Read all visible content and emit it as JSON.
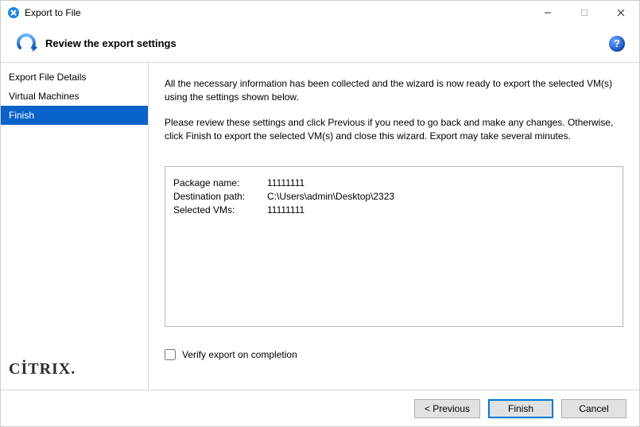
{
  "window": {
    "title": "Export to File"
  },
  "header": {
    "title": "Review the export settings"
  },
  "sidebar": {
    "items": [
      {
        "label": "Export File Details",
        "active": false
      },
      {
        "label": "Virtual Machines",
        "active": false
      },
      {
        "label": "Finish",
        "active": true
      }
    ],
    "brand": "CİTRIX",
    "brand_dot": "."
  },
  "content": {
    "para1": "All the necessary information has been collected and the wizard is now ready to export the selected VM(s) using the settings shown below.",
    "para2": "Please review these settings and click Previous if you need to go back and make any changes. Otherwise, click Finish to export the selected VM(s) and close this wizard. Export may take several minutes.",
    "settings": [
      {
        "label": "Package name:",
        "value": "11111111"
      },
      {
        "label": "Destination path:",
        "value": "C:\\Users\\admin\\Desktop\\2323"
      },
      {
        "label": "Selected VMs:",
        "value": "11111111"
      }
    ],
    "verify_label": "Verify export on completion",
    "verify_checked": false
  },
  "footer": {
    "previous": "< Previous",
    "finish": "Finish",
    "cancel": "Cancel"
  },
  "help_glyph": "?"
}
